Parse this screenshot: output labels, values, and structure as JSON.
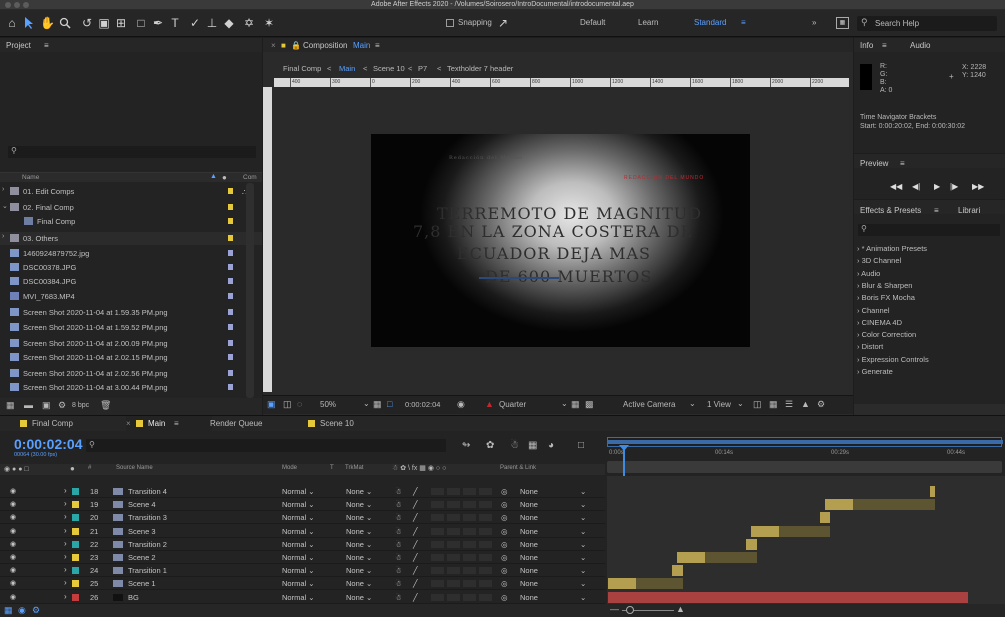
{
  "window": {
    "title": "Adobe After Effects 2020 - /Volumes/Soirosero/IntroDocumental/introdocumental.aep"
  },
  "toolbar": {
    "snapping_label": "Snapping",
    "workspaces": [
      "Default",
      "Learn",
      "Standard"
    ],
    "active_workspace": "Standard",
    "search_placeholder": "Search Help"
  },
  "project": {
    "title": "Project",
    "columns": {
      "name": "Name",
      "comment": "Com"
    },
    "items": [
      {
        "name": "01. Edit Comps",
        "type": "folder",
        "label_color": "#e6c93b"
      },
      {
        "name": "02. Final Comp",
        "type": "folder",
        "label_color": "#e6c93b"
      },
      {
        "name": "Final Comp",
        "type": "comp",
        "label_color": "#e6c93b"
      },
      {
        "name": "03. Others",
        "type": "folder",
        "label_color": "#e6c93b"
      },
      {
        "name": "1460924879752.jpg",
        "type": "image",
        "label_color": "#9aa2d6"
      },
      {
        "name": "DSC00378.JPG",
        "type": "image",
        "label_color": "#9aa2d6"
      },
      {
        "name": "DSC00384.JPG",
        "type": "image",
        "label_color": "#9aa2d6"
      },
      {
        "name": "MVI_7683.MP4",
        "type": "video",
        "label_color": "#9aa2d6"
      },
      {
        "name": "Screen Shot 2020-11-04 at 1.59.35 PM.png",
        "type": "image",
        "label_color": "#9aa2d6"
      },
      {
        "name": "Screen Shot 2020-11-04 at 1.59.52 PM.png",
        "type": "image",
        "label_color": "#9aa2d6"
      },
      {
        "name": "Screen Shot 2020-11-04 at 2.00.09 PM.png",
        "type": "image",
        "label_color": "#9aa2d6"
      },
      {
        "name": "Screen Shot 2020-11-04 at 2.02.15 PM.png",
        "type": "image",
        "label_color": "#9aa2d6"
      },
      {
        "name": "Screen Shot 2020-11-04 at 2.02.56 PM.png",
        "type": "image",
        "label_color": "#9aa2d6"
      },
      {
        "name": "Screen Shot 2020-11-04 at 3.00.44 PM.png",
        "type": "image",
        "label_color": "#9aa2d6"
      }
    ],
    "footer_bpc": "8 bpc"
  },
  "composition": {
    "title": "Composition",
    "comp_name": "Main",
    "breadcrumb": [
      "Final Comp",
      "Main",
      "Scene 10",
      "P7",
      "Textholder 7 header"
    ],
    "ruler_ticks": [
      "400",
      "300",
      "0",
      "200",
      "400",
      "600",
      "800",
      "1000",
      "1200",
      "1400",
      "1600",
      "1800",
      "2000",
      "2200"
    ],
    "video_text": {
      "top_left": "Redacción del Mundo",
      "red_stamp": "REDACCION DEL MUNDO",
      "line1": "TERREMOTO DE MAGNITUD",
      "line2": "7,8 EN LA ZONA COSTERA DE",
      "line3": "ECUADOR DEJA MAS",
      "line4": "DE 600 MUERTOS"
    },
    "footer": {
      "zoom": "50%",
      "timecode": "0:00:02:04",
      "resolution": "Quarter",
      "camera": "Active Camera",
      "views": "1 View"
    }
  },
  "info": {
    "tabs": [
      "Info",
      "Audio"
    ],
    "r_label": "R:",
    "g_label": "G:",
    "b_label": "B:",
    "a_label": "A: 0",
    "x_label": "X: 2228",
    "y_label": "Y: 1240",
    "nav_title": "Time Navigator Brackets",
    "nav_range": "Start: 0:00:20:02, End: 0:00:30:02"
  },
  "preview": {
    "title": "Preview"
  },
  "effects": {
    "tabs": [
      "Effects & Presets",
      "Librari"
    ],
    "items": [
      "* Animation Presets",
      "3D Channel",
      "Audio",
      "Blur & Sharpen",
      "Boris FX Mocha",
      "Channel",
      "CINEMA 4D",
      "Color Correction",
      "Distort",
      "Expression Controls",
      "Generate"
    ]
  },
  "timeline": {
    "tabs": [
      {
        "label": "Final Comp",
        "color": "#e6c93b"
      },
      {
        "label": "Main",
        "color": "#e6c93b",
        "active": true
      },
      {
        "label": "Render Queue",
        "color": ""
      },
      {
        "label": "Scene 10",
        "color": "#e6c93b"
      }
    ],
    "timecode": "0:00:02:04",
    "frames": "00064 (30.00 fps)",
    "columns": {
      "source_name": "Source Name",
      "mode": "Mode",
      "t": "T",
      "trkmat": "TrkMat",
      "parent": "Parent & Link"
    },
    "ruler_labels": [
      "0:00s",
      "00:14s",
      "00:29s",
      "00:44s"
    ],
    "layers": [
      {
        "num": "18",
        "name": "Transition 4",
        "label_color": "#2aa6a6",
        "mode": "Normal",
        "trkmat": "None",
        "parent": "None"
      },
      {
        "num": "19",
        "name": "Scene 4",
        "label_color": "#e6c93b",
        "mode": "Normal",
        "trkmat": "None",
        "parent": "None"
      },
      {
        "num": "20",
        "name": "Transition 3",
        "label_color": "#2aa6a6",
        "mode": "Normal",
        "trkmat": "None",
        "parent": "None"
      },
      {
        "num": "21",
        "name": "Scene 3",
        "label_color": "#e6c93b",
        "mode": "Normal",
        "trkmat": "None",
        "parent": "None"
      },
      {
        "num": "22",
        "name": "Transition 2",
        "label_color": "#2aa6a6",
        "mode": "Normal",
        "trkmat": "None",
        "parent": "None"
      },
      {
        "num": "23",
        "name": "Scene 2",
        "label_color": "#e6c93b",
        "mode": "Normal",
        "trkmat": "None",
        "parent": "None"
      },
      {
        "num": "24",
        "name": "Transition 1",
        "label_color": "#2aa6a6",
        "mode": "Normal",
        "trkmat": "None",
        "parent": "None"
      },
      {
        "num": "25",
        "name": "Scene 1",
        "label_color": "#e6c93b",
        "mode": "Normal",
        "trkmat": "None",
        "parent": "None"
      },
      {
        "num": "26",
        "name": "BG",
        "label_color": "#c43c3c",
        "mode": "Normal",
        "trkmat": "None",
        "parent": "None"
      }
    ]
  }
}
